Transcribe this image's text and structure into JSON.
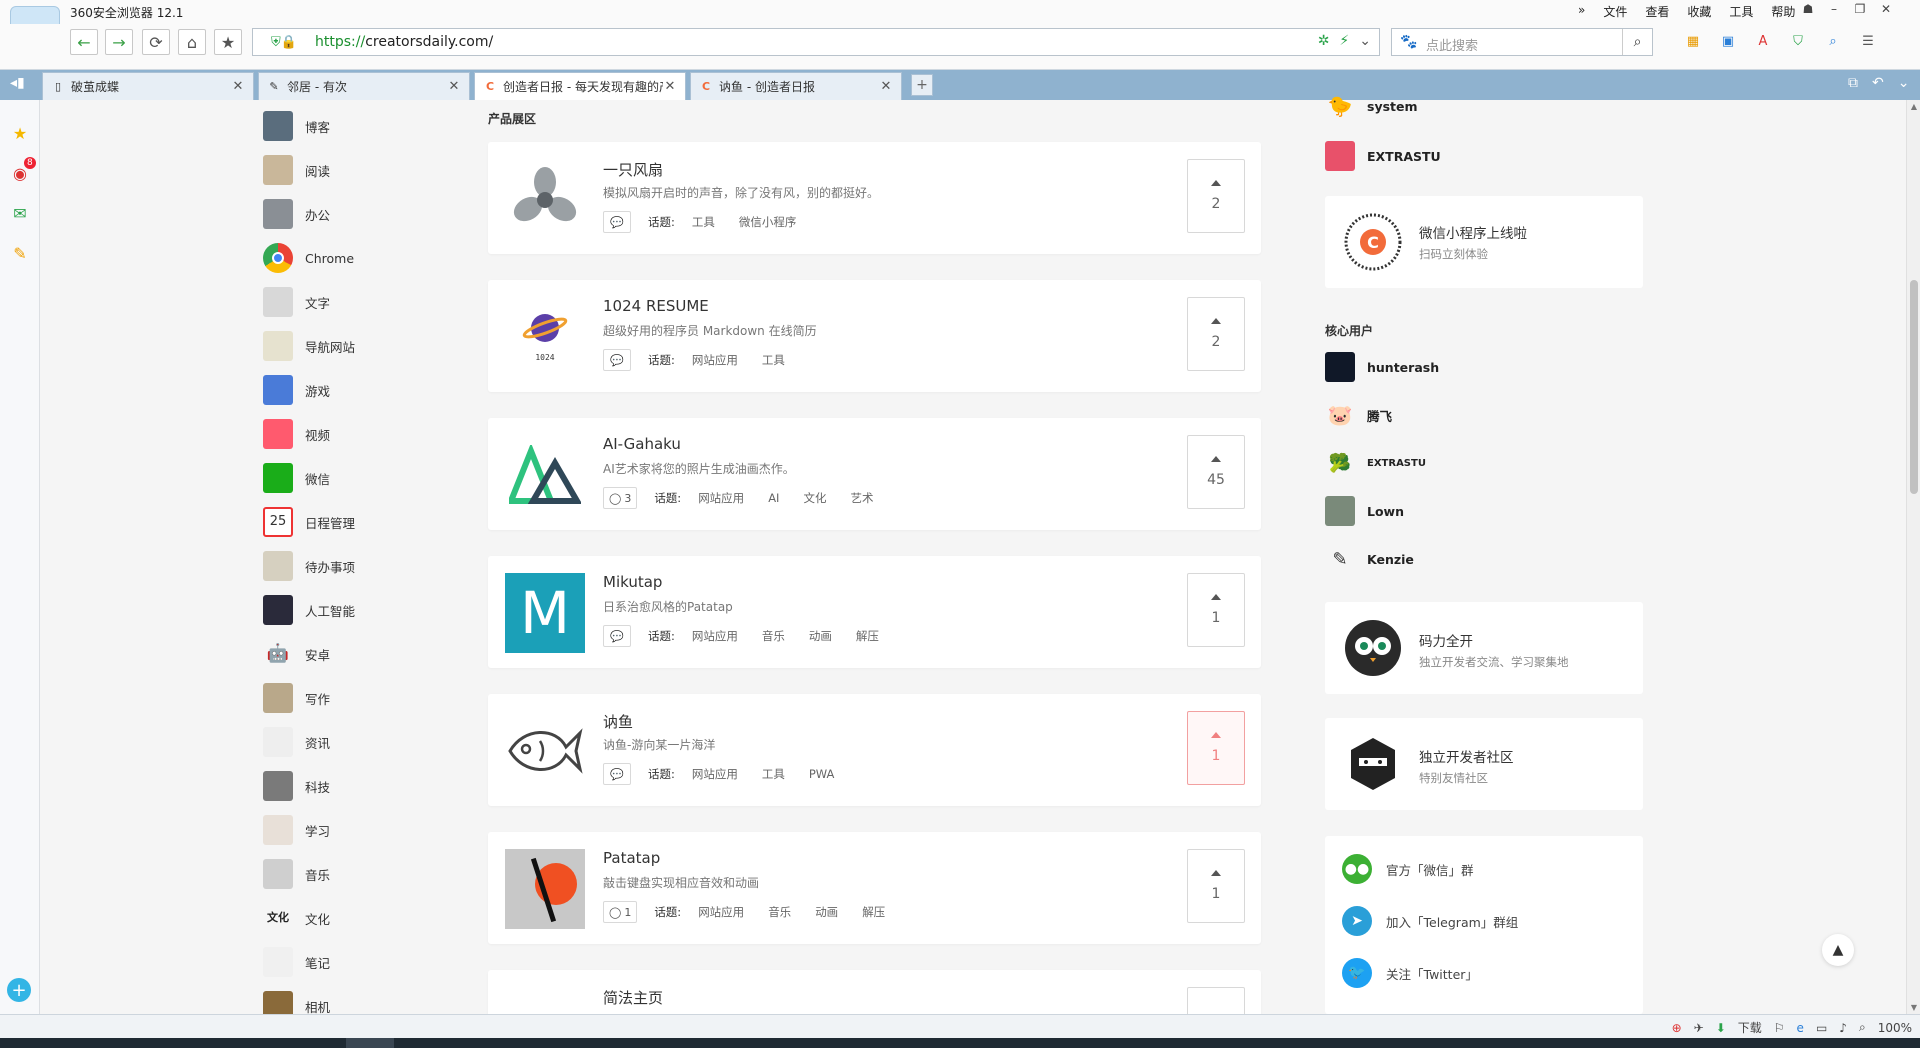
{
  "browser": {
    "app_title": "360安全浏览器 12.1",
    "menu": [
      "»",
      "文件",
      "查看",
      "收藏",
      "工具",
      "帮助"
    ],
    "url_scheme": "https://",
    "url_rest": "creatorsdaily.com/",
    "search_placeholder": "点此搜索",
    "tabs": [
      {
        "label": "破茧成蝶",
        "icon": "page-icon"
      },
      {
        "label": "邻居 - 有次",
        "icon": "feather-icon"
      },
      {
        "label": "创造者日报 - 每天发现有趣的产品",
        "icon": "c-logo-icon"
      },
      {
        "label": "讷鱼 - 创造者日报",
        "icon": "c-logo-icon"
      }
    ],
    "sidebar_badge": "8",
    "status_download": "下载",
    "zoom": "100%"
  },
  "categories": [
    "博客",
    "阅读",
    "办公",
    "Chrome",
    "文字",
    "导航网站",
    "游戏",
    "视频",
    "微信",
    "日程管理",
    "待办事项",
    "人工智能",
    "安卓",
    "写作",
    "资讯",
    "科技",
    "学习",
    "音乐",
    "文化",
    "笔记",
    "相机"
  ],
  "section_title": "产品展区",
  "topic_label": "话题:",
  "products": [
    {
      "name": "一只风扇",
      "desc": "模拟风扇开启时的声音，除了没有风，别的都挺好。",
      "comments": "",
      "tags": [
        "工具",
        "微信小程序"
      ],
      "votes": "2",
      "hot": false
    },
    {
      "name": "1024 RESUME",
      "desc": "超级好用的程序员 Markdown 在线简历",
      "comments": "",
      "tags": [
        "网站应用",
        "工具"
      ],
      "votes": "2",
      "hot": false
    },
    {
      "name": "AI-Gahaku",
      "desc": "AI艺术家将您的照片生成油画杰作。",
      "comments": "3",
      "tags": [
        "网站应用",
        "AI",
        "文化",
        "艺术"
      ],
      "votes": "45",
      "hot": false
    },
    {
      "name": "Mikutap",
      "desc": "日系治愈风格的Patatap",
      "comments": "",
      "tags": [
        "网站应用",
        "音乐",
        "动画",
        "解压"
      ],
      "votes": "1",
      "hot": false
    },
    {
      "name": "讷鱼",
      "desc": "讷鱼-游向某一片海洋",
      "comments": "",
      "tags": [
        "网站应用",
        "工具",
        "PWA"
      ],
      "votes": "1",
      "hot": true
    },
    {
      "name": "Patatap",
      "desc": "敲击键盘实现相应音效和动画",
      "comments": "1",
      "tags": [
        "网站应用",
        "音乐",
        "动画",
        "解压"
      ],
      "votes": "1",
      "hot": false
    },
    {
      "name": "简法主页",
      "desc": "",
      "comments": "",
      "tags": [],
      "votes": "",
      "hot": false
    }
  ],
  "top_users": [
    {
      "name": "system"
    },
    {
      "name": "EXTRASTU"
    }
  ],
  "miniprogram": {
    "title": "微信小程序上线啦",
    "sub": "扫码立刻体验"
  },
  "core_title": "核心用户",
  "core_users": [
    {
      "name": "hunterash"
    },
    {
      "name": "腾飞"
    },
    {
      "name": "EXTRASTU"
    },
    {
      "name": "Lown"
    },
    {
      "name": "Kenzie"
    }
  ],
  "communities": [
    {
      "title": "码力全开",
      "sub": "独立开发者交流、学习聚集地"
    },
    {
      "title": "独立开发者社区",
      "sub": "特别友情社区"
    }
  ],
  "links": [
    {
      "text": "官方「微信」群",
      "icon": "wechat-icon",
      "color": "#3cb034"
    },
    {
      "text": "加入「Telegram」群组",
      "icon": "telegram-icon",
      "color": "#2a9fd8"
    },
    {
      "text": "关注「Twitter」",
      "icon": "twitter-icon",
      "color": "#1da1f2"
    }
  ]
}
